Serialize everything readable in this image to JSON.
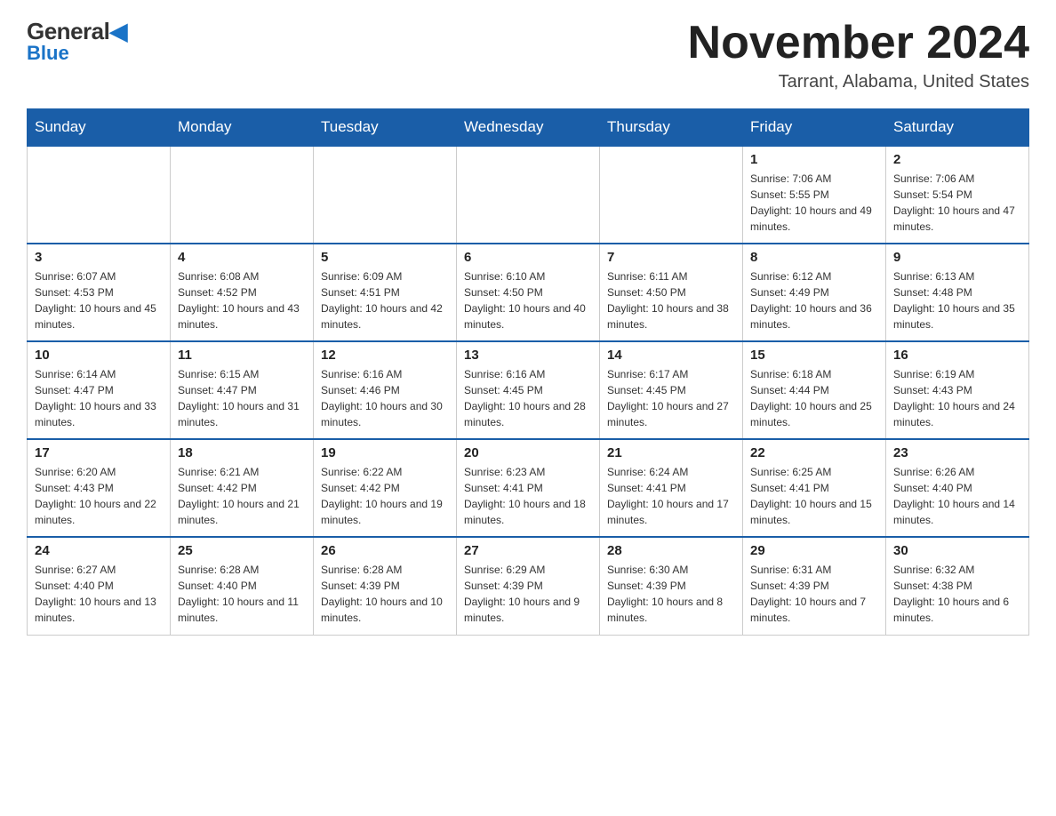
{
  "header": {
    "logo_general": "General",
    "logo_blue": "Blue",
    "month_title": "November 2024",
    "location": "Tarrant, Alabama, United States"
  },
  "days_of_week": [
    "Sunday",
    "Monday",
    "Tuesday",
    "Wednesday",
    "Thursday",
    "Friday",
    "Saturday"
  ],
  "weeks": [
    [
      {
        "day": "",
        "info": ""
      },
      {
        "day": "",
        "info": ""
      },
      {
        "day": "",
        "info": ""
      },
      {
        "day": "",
        "info": ""
      },
      {
        "day": "",
        "info": ""
      },
      {
        "day": "1",
        "info": "Sunrise: 7:06 AM\nSunset: 5:55 PM\nDaylight: 10 hours and 49 minutes."
      },
      {
        "day": "2",
        "info": "Sunrise: 7:06 AM\nSunset: 5:54 PM\nDaylight: 10 hours and 47 minutes."
      }
    ],
    [
      {
        "day": "3",
        "info": "Sunrise: 6:07 AM\nSunset: 4:53 PM\nDaylight: 10 hours and 45 minutes."
      },
      {
        "day": "4",
        "info": "Sunrise: 6:08 AM\nSunset: 4:52 PM\nDaylight: 10 hours and 43 minutes."
      },
      {
        "day": "5",
        "info": "Sunrise: 6:09 AM\nSunset: 4:51 PM\nDaylight: 10 hours and 42 minutes."
      },
      {
        "day": "6",
        "info": "Sunrise: 6:10 AM\nSunset: 4:50 PM\nDaylight: 10 hours and 40 minutes."
      },
      {
        "day": "7",
        "info": "Sunrise: 6:11 AM\nSunset: 4:50 PM\nDaylight: 10 hours and 38 minutes."
      },
      {
        "day": "8",
        "info": "Sunrise: 6:12 AM\nSunset: 4:49 PM\nDaylight: 10 hours and 36 minutes."
      },
      {
        "day": "9",
        "info": "Sunrise: 6:13 AM\nSunset: 4:48 PM\nDaylight: 10 hours and 35 minutes."
      }
    ],
    [
      {
        "day": "10",
        "info": "Sunrise: 6:14 AM\nSunset: 4:47 PM\nDaylight: 10 hours and 33 minutes."
      },
      {
        "day": "11",
        "info": "Sunrise: 6:15 AM\nSunset: 4:47 PM\nDaylight: 10 hours and 31 minutes."
      },
      {
        "day": "12",
        "info": "Sunrise: 6:16 AM\nSunset: 4:46 PM\nDaylight: 10 hours and 30 minutes."
      },
      {
        "day": "13",
        "info": "Sunrise: 6:16 AM\nSunset: 4:45 PM\nDaylight: 10 hours and 28 minutes."
      },
      {
        "day": "14",
        "info": "Sunrise: 6:17 AM\nSunset: 4:45 PM\nDaylight: 10 hours and 27 minutes."
      },
      {
        "day": "15",
        "info": "Sunrise: 6:18 AM\nSunset: 4:44 PM\nDaylight: 10 hours and 25 minutes."
      },
      {
        "day": "16",
        "info": "Sunrise: 6:19 AM\nSunset: 4:43 PM\nDaylight: 10 hours and 24 minutes."
      }
    ],
    [
      {
        "day": "17",
        "info": "Sunrise: 6:20 AM\nSunset: 4:43 PM\nDaylight: 10 hours and 22 minutes."
      },
      {
        "day": "18",
        "info": "Sunrise: 6:21 AM\nSunset: 4:42 PM\nDaylight: 10 hours and 21 minutes."
      },
      {
        "day": "19",
        "info": "Sunrise: 6:22 AM\nSunset: 4:42 PM\nDaylight: 10 hours and 19 minutes."
      },
      {
        "day": "20",
        "info": "Sunrise: 6:23 AM\nSunset: 4:41 PM\nDaylight: 10 hours and 18 minutes."
      },
      {
        "day": "21",
        "info": "Sunrise: 6:24 AM\nSunset: 4:41 PM\nDaylight: 10 hours and 17 minutes."
      },
      {
        "day": "22",
        "info": "Sunrise: 6:25 AM\nSunset: 4:41 PM\nDaylight: 10 hours and 15 minutes."
      },
      {
        "day": "23",
        "info": "Sunrise: 6:26 AM\nSunset: 4:40 PM\nDaylight: 10 hours and 14 minutes."
      }
    ],
    [
      {
        "day": "24",
        "info": "Sunrise: 6:27 AM\nSunset: 4:40 PM\nDaylight: 10 hours and 13 minutes."
      },
      {
        "day": "25",
        "info": "Sunrise: 6:28 AM\nSunset: 4:40 PM\nDaylight: 10 hours and 11 minutes."
      },
      {
        "day": "26",
        "info": "Sunrise: 6:28 AM\nSunset: 4:39 PM\nDaylight: 10 hours and 10 minutes."
      },
      {
        "day": "27",
        "info": "Sunrise: 6:29 AM\nSunset: 4:39 PM\nDaylight: 10 hours and 9 minutes."
      },
      {
        "day": "28",
        "info": "Sunrise: 6:30 AM\nSunset: 4:39 PM\nDaylight: 10 hours and 8 minutes."
      },
      {
        "day": "29",
        "info": "Sunrise: 6:31 AM\nSunset: 4:39 PM\nDaylight: 10 hours and 7 minutes."
      },
      {
        "day": "30",
        "info": "Sunrise: 6:32 AM\nSunset: 4:38 PM\nDaylight: 10 hours and 6 minutes."
      }
    ]
  ]
}
